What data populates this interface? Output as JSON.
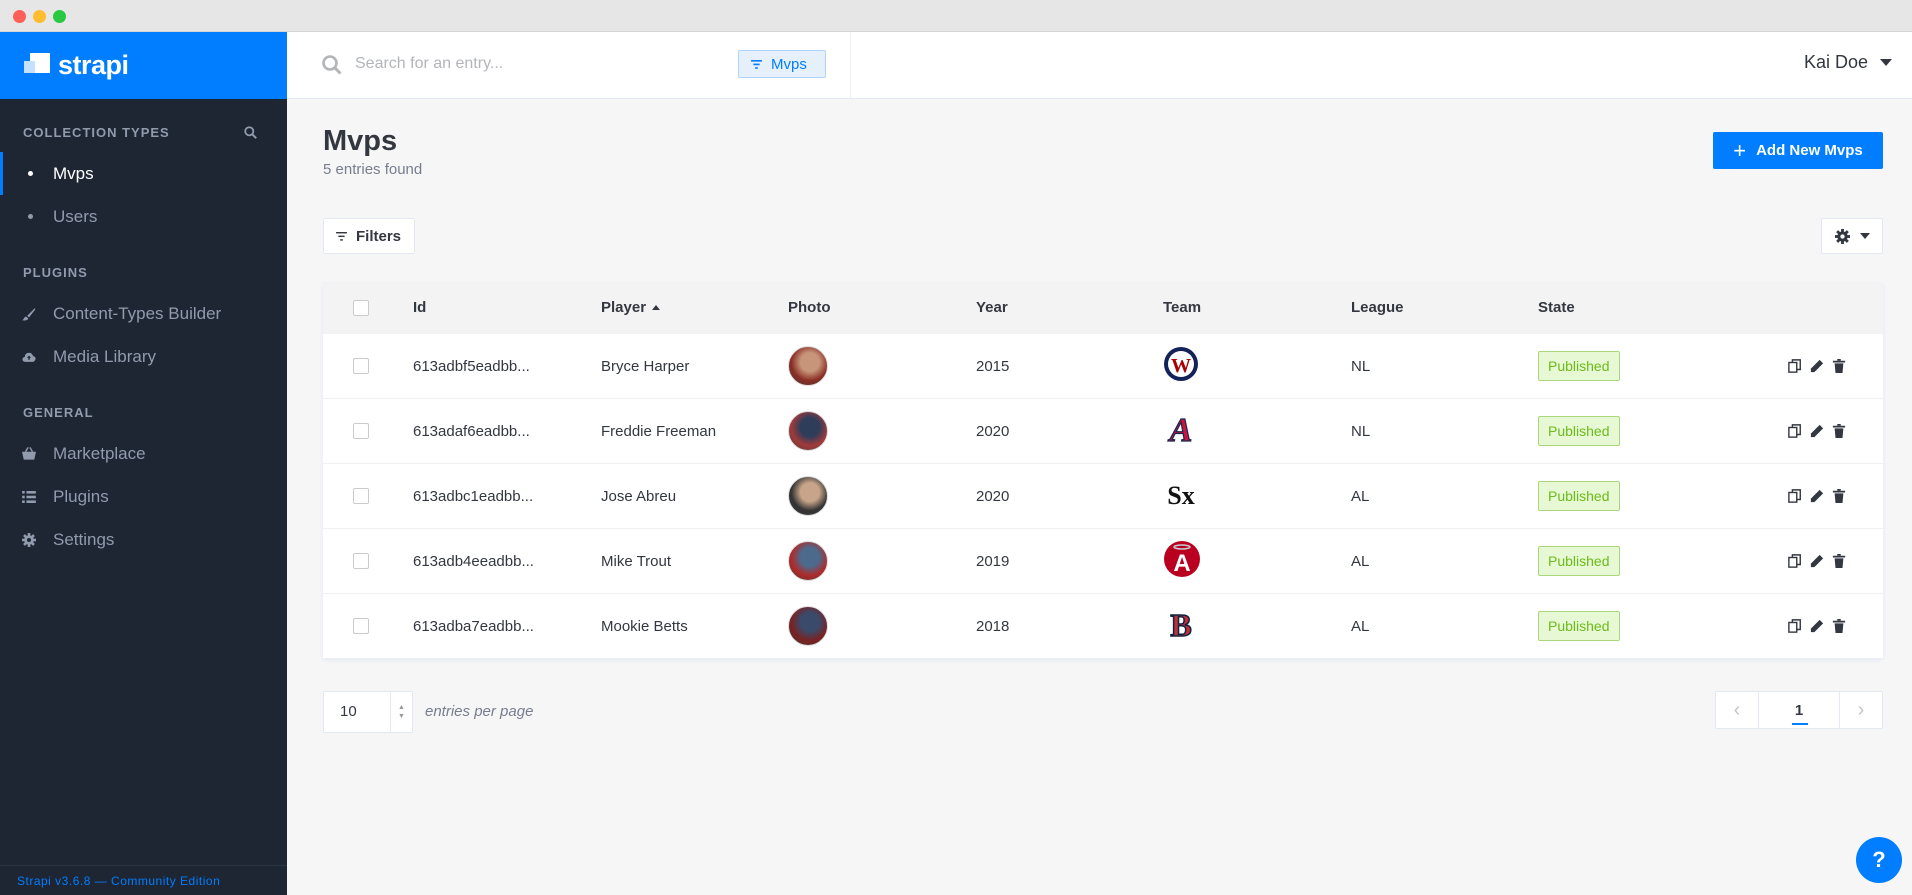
{
  "sidebar": {
    "brand": "strapi",
    "collection_title": "COLLECTION TYPES",
    "collection_items": [
      {
        "label": "Mvps"
      },
      {
        "label": "Users"
      }
    ],
    "plugins_title": "PLUGINS",
    "plugin_items": [
      {
        "label": "Content-Types Builder",
        "icon": "brush-icon"
      },
      {
        "label": "Media Library",
        "icon": "cloud-upload-icon"
      }
    ],
    "general_title": "GENERAL",
    "general_items": [
      {
        "label": "Marketplace",
        "icon": "basket-icon"
      },
      {
        "label": "Plugins",
        "icon": "list-icon"
      },
      {
        "label": "Settings",
        "icon": "gear-icon"
      }
    ],
    "footer": "Strapi v3.6.8 — Community Edition"
  },
  "topbar": {
    "search_placeholder": "Search for an entry...",
    "chip_label": "Mvps",
    "user_name": "Kai Doe"
  },
  "main": {
    "title": "Mvps",
    "count": "5 entries found",
    "add_label": "Add New Mvps",
    "filters_label": "Filters",
    "columns": [
      "Id",
      "Player",
      "Photo",
      "Year",
      "Team",
      "League",
      "State"
    ],
    "sort_column": "Player",
    "rows": [
      {
        "id": "613adbf5eadbb...",
        "player": "Bryce Harper",
        "year": "2015",
        "team": "nationals",
        "league": "NL",
        "state": "Published"
      },
      {
        "id": "613adaf6eadbb...",
        "player": "Freddie Freeman",
        "year": "2020",
        "team": "braves",
        "league": "NL",
        "state": "Published"
      },
      {
        "id": "613adbc1eadbb...",
        "player": "Jose Abreu",
        "year": "2020",
        "team": "white-sox",
        "league": "AL",
        "state": "Published"
      },
      {
        "id": "613adb4eeadbb...",
        "player": "Mike Trout",
        "year": "2019",
        "team": "angels",
        "league": "AL",
        "state": "Published"
      },
      {
        "id": "613adba7eadbb...",
        "player": "Mookie Betts",
        "year": "2018",
        "team": "red-sox",
        "league": "AL",
        "state": "Published"
      }
    ],
    "per_page": "10",
    "per_page_label": "entries per page",
    "current_page": "1"
  },
  "colors": {
    "accent": "#007eff",
    "sidebar_bg": "#1e2533",
    "published_green": "#6dbb1a"
  }
}
